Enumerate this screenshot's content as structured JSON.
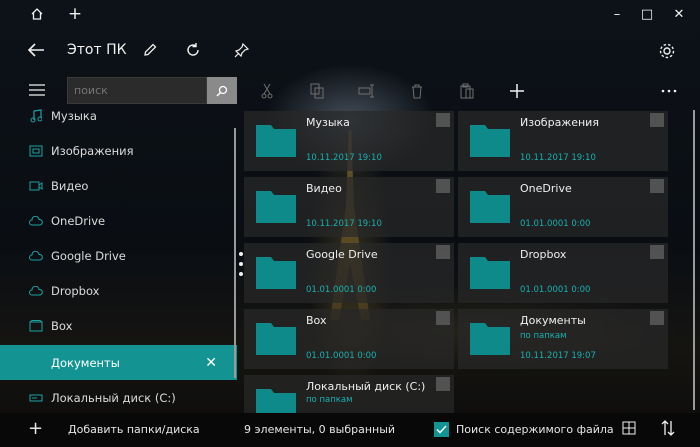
{
  "window": {
    "title": "Этот ПК",
    "controls": {
      "minimize": "–",
      "maximize": "□",
      "close": "✕"
    }
  },
  "toolbar": {
    "search_placeholder": "поиск",
    "icons": [
      "cut-icon",
      "copy-icon",
      "rename-icon",
      "delete-icon",
      "paste-icon",
      "add-icon",
      "more-icon"
    ]
  },
  "sidebar": {
    "items": [
      {
        "label": "Музыка",
        "icon": "music-icon"
      },
      {
        "label": "Изображения",
        "icon": "image-icon"
      },
      {
        "label": "Видео",
        "icon": "video-icon"
      },
      {
        "label": "OneDrive",
        "icon": "cloud-icon"
      },
      {
        "label": "Google Drive",
        "icon": "cloud-icon"
      },
      {
        "label": "Dropbox",
        "icon": "cloud-icon"
      },
      {
        "label": "Box",
        "icon": "box-icon"
      },
      {
        "label": "Документы",
        "icon": "document-icon",
        "active": true
      },
      {
        "label": "Локальный диск (C:)",
        "icon": "drive-icon"
      }
    ]
  },
  "items": [
    {
      "name": "Музыка",
      "date": "10.11.2017 19:10"
    },
    {
      "name": "Изображения",
      "date": "10.11.2017 19:10"
    },
    {
      "name": "Видео",
      "date": "10.11.2017 19:10"
    },
    {
      "name": "OneDrive",
      "date": "01.01.0001 0:00"
    },
    {
      "name": "Google Drive",
      "date": "01.01.0001 0:00"
    },
    {
      "name": "Dropbox",
      "date": "01.01.0001 0:00"
    },
    {
      "name": "Box",
      "date": "01.01.0001 0:00"
    },
    {
      "name": "Документы",
      "date": "10.11.2017 19:07",
      "sub": "по папкам"
    },
    {
      "name": "Локальный диск (C:)",
      "sub": "по папкам"
    }
  ],
  "status": {
    "add_label": "Добавить папки/диска",
    "count": "9 элементы, 0 выбранный",
    "content_search_label": "Поиск содержимого файла",
    "content_search_checked": true
  },
  "colors": {
    "accent": "#149393",
    "tile": "#282828"
  }
}
